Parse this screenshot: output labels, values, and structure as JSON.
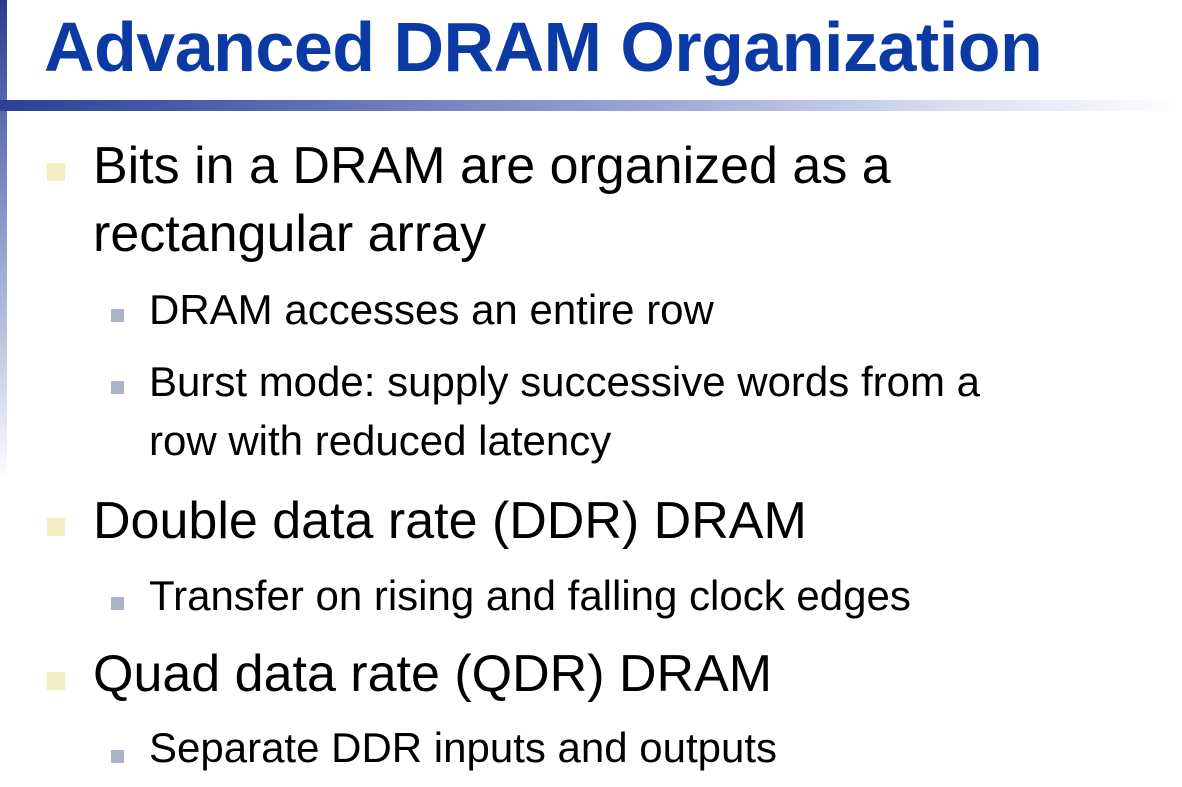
{
  "slide": {
    "title": "Advanced DRAM Organization",
    "bullets": [
      {
        "lines": [
          "Bits in a DRAM are organized as a",
          "rectangular array"
        ],
        "subs": [
          {
            "lines": [
              "DRAM accesses an entire row"
            ]
          },
          {
            "lines": [
              "Burst mode: supply successive words from a",
              "row with reduced latency"
            ]
          }
        ]
      },
      {
        "lines": [
          "Double data rate (DDR) DRAM"
        ],
        "subs": [
          {
            "lines": [
              "Transfer on rising and falling clock edges"
            ]
          }
        ]
      },
      {
        "lines": [
          "Quad data rate (QDR) DRAM"
        ],
        "subs": [
          {
            "lines": [
              "Separate DDR inputs and outputs"
            ]
          }
        ]
      }
    ]
  },
  "colors": {
    "title": "#0b3aa4",
    "level1_marker": "#f2efc4",
    "level2_marker": "#a9b4c4"
  }
}
